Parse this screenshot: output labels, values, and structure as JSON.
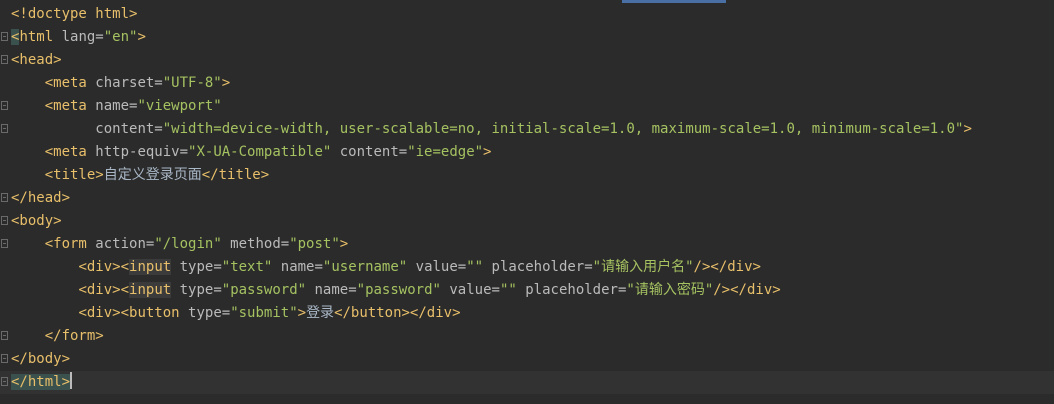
{
  "editor": {
    "colors": {
      "background": "#2b2b2b",
      "current_line": "#323232",
      "tag": "#e8bf6a",
      "attribute": "#bababa",
      "value": "#a5c261",
      "text": "#a9b7c6",
      "fold_icon": "#6a6a6a",
      "scroll_marker": "#4a6fa5"
    },
    "lines": [
      {
        "fold": false,
        "current": false,
        "indent": "",
        "tokens": [
          {
            "t": "doctype",
            "v": "<!doctype html>"
          }
        ]
      },
      {
        "fold": true,
        "current": false,
        "indent": "",
        "tokens": [
          {
            "t": "tag",
            "v": "<",
            "hl": "match"
          },
          {
            "t": "tag",
            "v": "html"
          },
          {
            "t": "attr",
            "v": " lang="
          },
          {
            "t": "val",
            "v": "\"en\""
          },
          {
            "t": "tag",
            "v": ">"
          }
        ]
      },
      {
        "fold": true,
        "current": false,
        "indent": "",
        "tokens": [
          {
            "t": "tag",
            "v": "<head>"
          }
        ]
      },
      {
        "fold": false,
        "current": false,
        "indent": "    ",
        "tokens": [
          {
            "t": "tag",
            "v": "<meta"
          },
          {
            "t": "attr",
            "v": " charset="
          },
          {
            "t": "val",
            "v": "\"UTF-8\""
          },
          {
            "t": "tag",
            "v": ">"
          }
        ]
      },
      {
        "fold": true,
        "current": false,
        "indent": "    ",
        "tokens": [
          {
            "t": "tag",
            "v": "<meta"
          },
          {
            "t": "attr",
            "v": " name="
          },
          {
            "t": "val",
            "v": "\"viewport\""
          }
        ]
      },
      {
        "fold": true,
        "current": false,
        "indent": "          ",
        "tokens": [
          {
            "t": "attr",
            "v": "content="
          },
          {
            "t": "val",
            "v": "\"width=device-width, user-scalable=no, initial-scale=1.0, maximum-scale=1.0, minimum-scale=1.0\""
          },
          {
            "t": "tag",
            "v": ">"
          }
        ]
      },
      {
        "fold": false,
        "current": false,
        "indent": "    ",
        "tokens": [
          {
            "t": "tag",
            "v": "<meta"
          },
          {
            "t": "attr",
            "v": " http-equiv="
          },
          {
            "t": "val",
            "v": "\"X-UA-Compatible\""
          },
          {
            "t": "attr",
            "v": " content="
          },
          {
            "t": "val",
            "v": "\"ie=edge\""
          },
          {
            "t": "tag",
            "v": ">"
          }
        ]
      },
      {
        "fold": false,
        "current": false,
        "indent": "    ",
        "tokens": [
          {
            "t": "tag",
            "v": "<title>"
          },
          {
            "t": "text",
            "v": "自定义登录页面"
          },
          {
            "t": "tag",
            "v": "</title>"
          }
        ]
      },
      {
        "fold": true,
        "current": false,
        "indent": "",
        "tokens": [
          {
            "t": "tag",
            "v": "</head>"
          }
        ]
      },
      {
        "fold": true,
        "current": false,
        "indent": "",
        "tokens": [
          {
            "t": "tag",
            "v": "<body>"
          }
        ]
      },
      {
        "fold": true,
        "current": false,
        "indent": "    ",
        "tokens": [
          {
            "t": "tag",
            "v": "<form"
          },
          {
            "t": "attr",
            "v": " action="
          },
          {
            "t": "val",
            "v": "\"/login\""
          },
          {
            "t": "attr",
            "v": " method="
          },
          {
            "t": "val",
            "v": "\"post\""
          },
          {
            "t": "tag",
            "v": ">"
          }
        ]
      },
      {
        "fold": false,
        "current": false,
        "indent": "        ",
        "tokens": [
          {
            "t": "tag",
            "v": "<div>"
          },
          {
            "t": "tag",
            "v": "<"
          },
          {
            "t": "tag",
            "v": "input",
            "hl": "hl"
          },
          {
            "t": "attr",
            "v": " type="
          },
          {
            "t": "val",
            "v": "\"text\""
          },
          {
            "t": "attr",
            "v": " name="
          },
          {
            "t": "val",
            "v": "\"username\""
          },
          {
            "t": "attr",
            "v": " value="
          },
          {
            "t": "val",
            "v": "\"\""
          },
          {
            "t": "attr",
            "v": " placeholder="
          },
          {
            "t": "val",
            "v": "\"请输入用户名\""
          },
          {
            "t": "tag",
            "v": "/>"
          },
          {
            "t": "tag",
            "v": "</div>"
          }
        ]
      },
      {
        "fold": false,
        "current": false,
        "indent": "        ",
        "tokens": [
          {
            "t": "tag",
            "v": "<div>"
          },
          {
            "t": "tag",
            "v": "<"
          },
          {
            "t": "tag",
            "v": "input",
            "hl": "hl"
          },
          {
            "t": "attr",
            "v": " type="
          },
          {
            "t": "val",
            "v": "\"password\""
          },
          {
            "t": "attr",
            "v": " name="
          },
          {
            "t": "val",
            "v": "\"password\""
          },
          {
            "t": "attr",
            "v": " value="
          },
          {
            "t": "val",
            "v": "\"\""
          },
          {
            "t": "attr",
            "v": " placeholder="
          },
          {
            "t": "val",
            "v": "\"请输入密码\""
          },
          {
            "t": "tag",
            "v": "/>"
          },
          {
            "t": "tag",
            "v": "</div>"
          }
        ]
      },
      {
        "fold": false,
        "current": false,
        "indent": "        ",
        "tokens": [
          {
            "t": "tag",
            "v": "<div>"
          },
          {
            "t": "tag",
            "v": "<button"
          },
          {
            "t": "attr",
            "v": " type="
          },
          {
            "t": "val",
            "v": "\"submit\""
          },
          {
            "t": "tag",
            "v": ">"
          },
          {
            "t": "text",
            "v": "登录"
          },
          {
            "t": "tag",
            "v": "</button>"
          },
          {
            "t": "tag",
            "v": "</div>"
          }
        ]
      },
      {
        "fold": true,
        "current": false,
        "indent": "    ",
        "tokens": [
          {
            "t": "tag",
            "v": "</form>"
          }
        ]
      },
      {
        "fold": true,
        "current": false,
        "indent": "",
        "tokens": [
          {
            "t": "tag",
            "v": "</body>"
          }
        ]
      },
      {
        "fold": true,
        "current": true,
        "indent": "",
        "tokens": [
          {
            "t": "tag",
            "v": "</html",
            "hl": "match"
          },
          {
            "t": "tag",
            "v": ">",
            "hl": "match"
          }
        ],
        "caret": true
      }
    ]
  }
}
